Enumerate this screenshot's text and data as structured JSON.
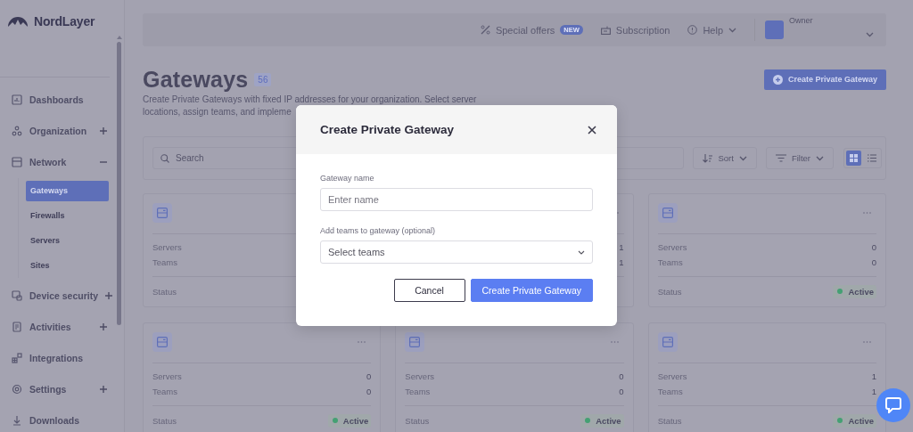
{
  "sidebar": {
    "logo": "NordLayer",
    "items": [
      {
        "label": "Dashboards",
        "kind": "link"
      },
      {
        "label": "Organization",
        "kind": "group",
        "expanded": false
      },
      {
        "label": "Network",
        "kind": "group",
        "expanded": true,
        "children": [
          {
            "label": "Gateways",
            "selected": true
          },
          {
            "label": "Firewalls",
            "selected": false
          },
          {
            "label": "Servers",
            "selected": false
          },
          {
            "label": "Sites",
            "selected": false
          }
        ]
      },
      {
        "label": "Device security",
        "kind": "group",
        "expanded": false
      },
      {
        "label": "Activities",
        "kind": "group",
        "expanded": false
      },
      {
        "label": "Integrations",
        "kind": "link"
      },
      {
        "label": "Settings",
        "kind": "group",
        "expanded": false
      },
      {
        "label": "Downloads",
        "kind": "link"
      }
    ]
  },
  "header": {
    "special_offers": {
      "label": "Special offers",
      "badge": "NEW"
    },
    "subscription": "Subscription",
    "help": "Help",
    "user": {
      "role": "Owner"
    }
  },
  "page": {
    "title": "Gateways",
    "count": "56",
    "description": [
      "Create Private Gateways with fixed IP addresses for your organization. Select server",
      "locations, assign teams, and impleme"
    ],
    "create_button": "Create Private Gateway"
  },
  "toolbar": {
    "search": {
      "placeholder": "Search"
    },
    "sort": "Sort",
    "filter": "Filter",
    "views": [
      {
        "kind": "grid",
        "selected": true
      },
      {
        "kind": "list",
        "selected": false
      }
    ]
  },
  "cards": [
    {
      "rows": [
        {
          "label": "Servers"
        },
        {
          "label": "Teams"
        }
      ],
      "status": {
        "label": "Status"
      }
    },
    {
      "rows": [
        {
          "value": "1"
        },
        {
          "value": "1"
        }
      ]
    },
    {
      "rows": [
        {
          "label": "Servers",
          "value": "0"
        },
        {
          "label": "Teams",
          "value": "0"
        }
      ],
      "status": {
        "label": "Status",
        "value": "Active"
      }
    },
    {
      "rows": [
        {
          "label": "Servers",
          "value": "0"
        },
        {
          "label": "Teams",
          "value": "0"
        }
      ],
      "status": {
        "label": "Status",
        "value": "Active"
      }
    },
    {
      "rows": [
        {
          "label": "Servers",
          "value": "0"
        },
        {
          "label": "Teams",
          "value": "0"
        }
      ],
      "status": {
        "label": "Status",
        "value": "Active"
      }
    },
    {
      "rows": [
        {
          "label": "Servers",
          "value": "1"
        },
        {
          "label": "Teams",
          "value": "1"
        }
      ],
      "status": {
        "label": "Status",
        "value": "Active"
      }
    }
  ],
  "modal": {
    "title": "Create Private Gateway",
    "fields": [
      {
        "kind": "text",
        "label": "Gateway name",
        "placeholder": "Enter name"
      },
      {
        "kind": "select",
        "label": "Add teams to gateway (optional)",
        "placeholder": "Select teams"
      }
    ],
    "buttons": [
      {
        "kind": "secondary",
        "label": "Cancel"
      },
      {
        "kind": "primary",
        "label": "Create Private Gateway"
      }
    ]
  }
}
